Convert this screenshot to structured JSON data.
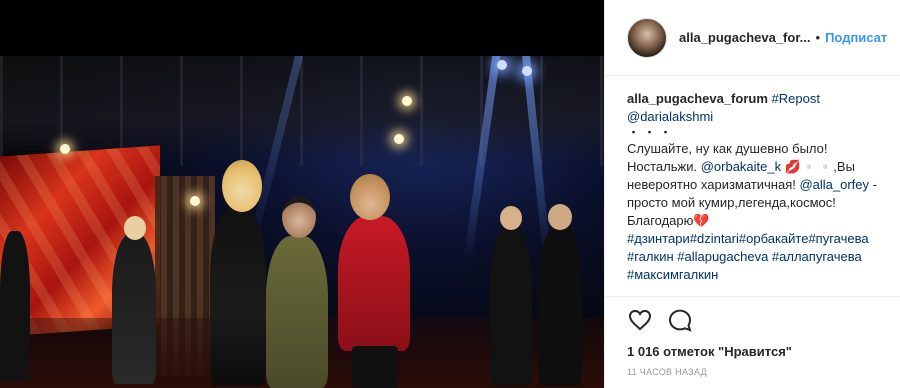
{
  "header": {
    "username": "alla_pugacheva_for...",
    "separator": "•",
    "follow_label": "Подписат"
  },
  "caption": {
    "username": "alla_pugacheva_forum",
    "repost_tag": "#Repost",
    "mention_source": "@darialakshmi",
    "dots": "・・・",
    "line1": "Слушайте, ну как душевно было!",
    "line2_pre": "Ностальжи. ",
    "mention_orbakaite": "@orbakaite_k",
    "line2_post": " 💋▫️▫️,Вы",
    "line3_pre": "невероятно харизматичная! ",
    "mention_orfey": "@alla_orfey",
    "line3_post": " -",
    "line4": "просто мой кумир,легенда,космос!",
    "line5": "Благодарю💔",
    "tags_line1": "#дзинтари#dzintari#орбакайте#пугачева",
    "tags_line2": "#галкин #allapugacheva #аллапугачева",
    "tags_line3": "#максимгалкин"
  },
  "actions": {
    "like_icon": "heart-icon",
    "comment_icon": "comment-icon"
  },
  "likes_text": "1 016 отметок \"Нравится\"",
  "timestamp": "11 ЧАСОВ НАЗАД"
}
